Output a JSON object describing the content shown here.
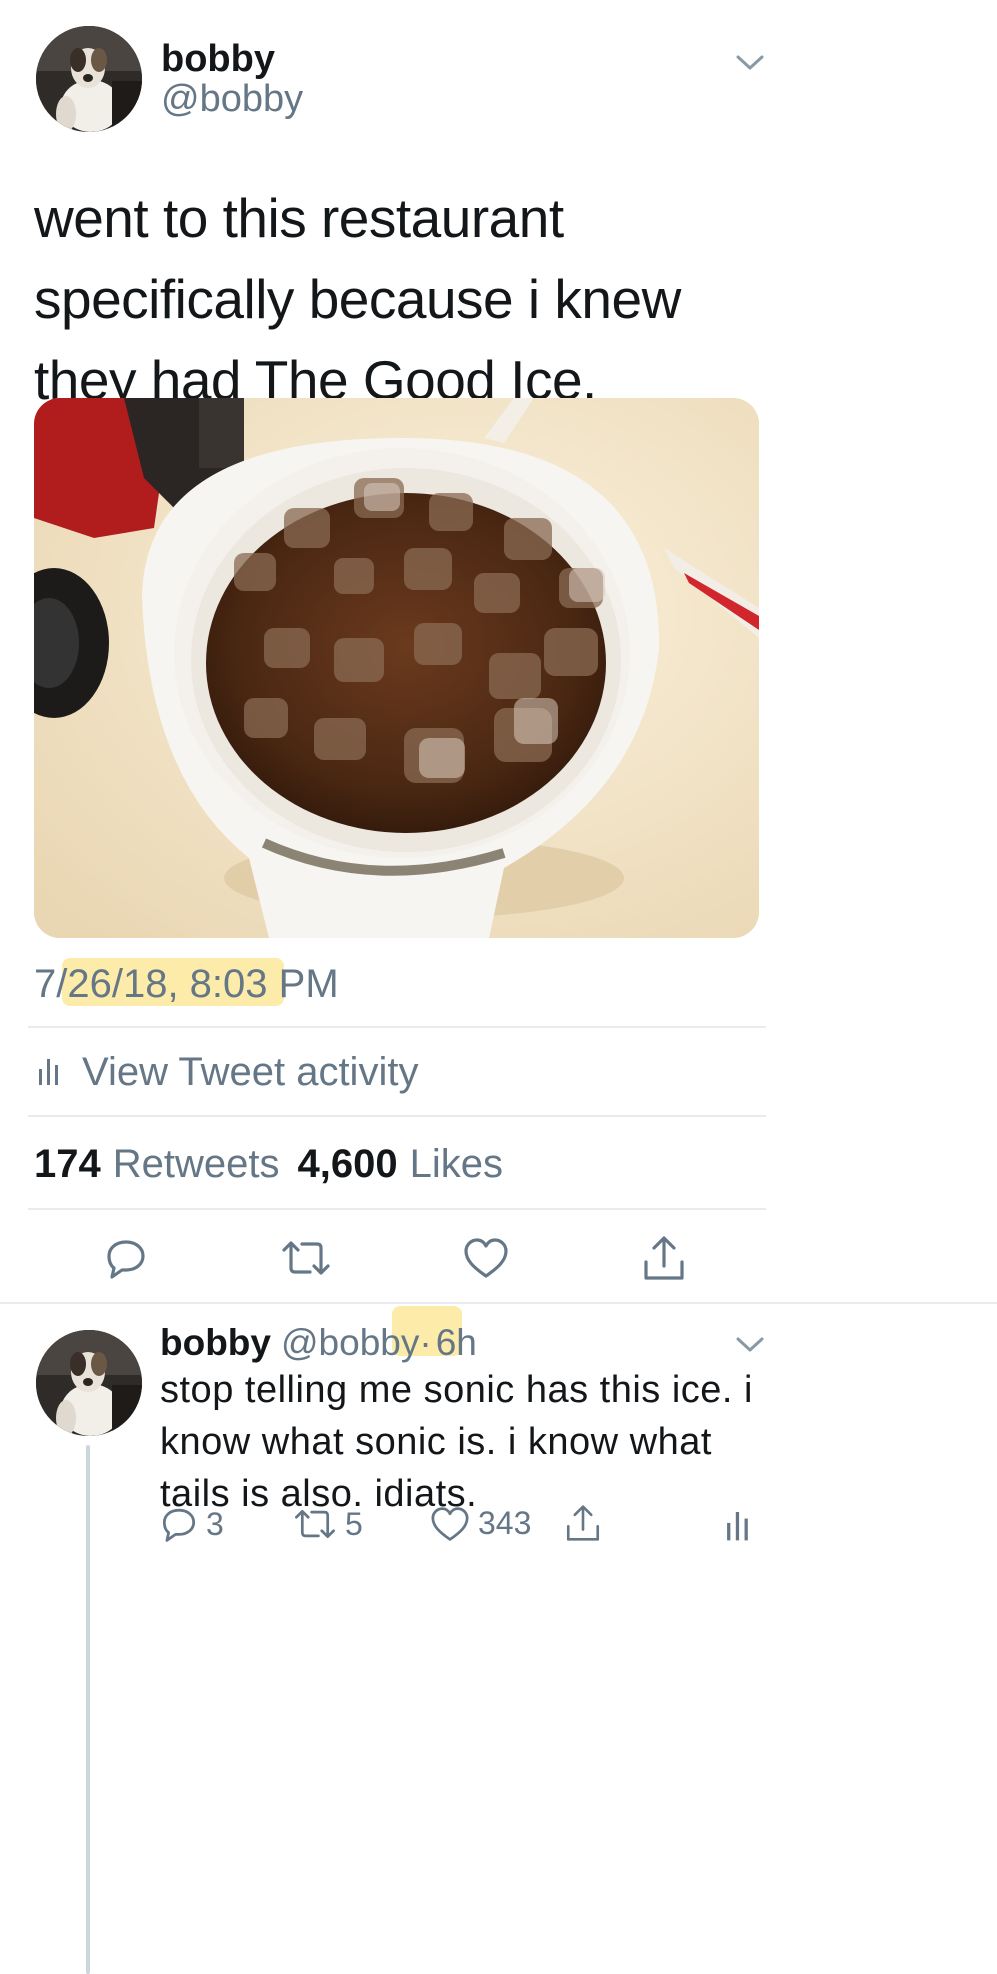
{
  "tweet": {
    "author_name": "bobby",
    "author_handle": "@bobby",
    "text": "went to this restaurant specifically because i knew they had The Good Ice.",
    "timestamp": "7/26/18, 8:03 PM",
    "view_activity_label": "View Tweet activity",
    "retweets_count": "174",
    "retweets_label": "Retweets",
    "likes_count": "4,600",
    "likes_label": "Likes"
  },
  "reply": {
    "author_name": "bobby",
    "author_handle": "@bobby",
    "separator": "·",
    "time": "6h",
    "text": "stop telling me sonic has this ice. i know what sonic is. i know what tails is also. idiats.",
    "reply_count": "3",
    "retweet_count": "5",
    "like_count": "343"
  },
  "colors": {
    "text_primary": "#14171a",
    "text_secondary": "#657786",
    "divider": "#e6ecf0",
    "highlight": "#fbe89a"
  },
  "icons": [
    "chevron-down-icon",
    "reply-icon",
    "retweet-icon",
    "like-icon",
    "share-icon",
    "analytics-icon"
  ]
}
